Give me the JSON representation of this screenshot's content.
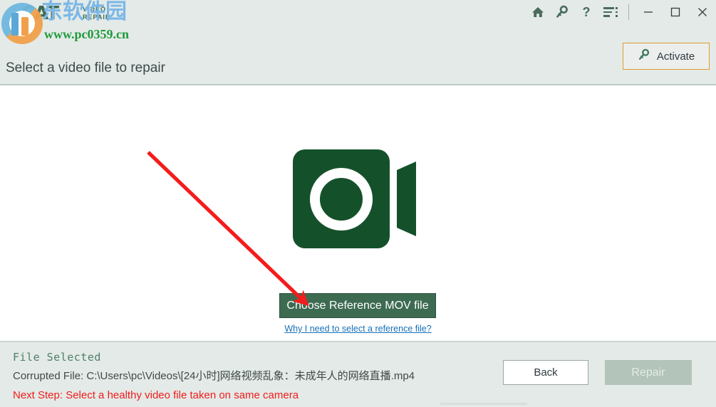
{
  "window": {
    "titlebar_icons": [
      {
        "name": "home-icon",
        "glyph": "⌂"
      },
      {
        "name": "key-icon",
        "glyph": "⚷"
      },
      {
        "name": "help-icon",
        "glyph": "?"
      },
      {
        "name": "menu-icon",
        "glyph": ""
      }
    ],
    "minimize_label": "—",
    "maximize_label": "□",
    "close_label": "✕"
  },
  "brand": {
    "name": "CAT",
    "sub_line1": "VIDEO",
    "sub_line2": "REPAIR",
    "ears": "^-^"
  },
  "watermark": {
    "cn_text": "东软件园",
    "url": "www.pc0359.cn",
    "cn_color": "#7cb8e8",
    "url_color": "#1f9a3d"
  },
  "header": {
    "page_title": "Select a video file to repair",
    "activate_label": "Activate",
    "activate_border_color": "#e09c2e"
  },
  "main": {
    "camera_icon_name": "video-camera-icon",
    "camera_color": "#14512a",
    "choose_button_label": "Choose Reference MOV file",
    "choose_button_color": "#3d6b52",
    "why_link_label": "Why I need to select a reference file?",
    "why_link_color": "#1570b8",
    "annotation_arrow_color": "#f41c1c"
  },
  "footer": {
    "status_title": "File Selected",
    "status_title_color": "#4f7f6a",
    "corrupted_file_label": "Corrupted File: C:\\Users\\pc\\Videos\\[24小时]网络视频乱象：未成年人的网络直播.mp4",
    "next_step_label": "Next Step: Select a healthy video file taken on same camera",
    "next_step_color": "#ef1c1c",
    "back_button_label": "Back",
    "repair_button_label": "Repair",
    "repair_button_enabled": false
  }
}
